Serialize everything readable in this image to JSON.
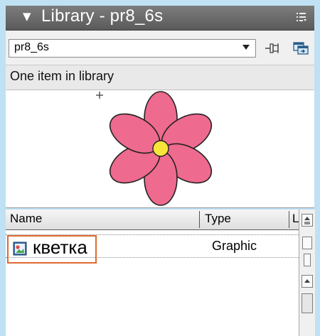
{
  "panel": {
    "title": "Library - pr8_6s",
    "collapse_glyph": "▼",
    "options_icon": "panel-options-icon"
  },
  "toolbar": {
    "selected_library": "pr8_6s",
    "pin_icon": "pin-library-icon",
    "new_window_icon": "new-library-panel-icon"
  },
  "status": {
    "text": "One item in library"
  },
  "preview": {
    "symbol": "flower",
    "petal_color": "#ee6a8e",
    "center_color": "#f7e53a"
  },
  "list": {
    "columns": [
      {
        "label": "Name"
      },
      {
        "label": "Type"
      },
      {
        "label": "Li"
      }
    ],
    "items": [
      {
        "name": "кветка",
        "type": "Graphic",
        "icon": "graphic-symbol-icon"
      }
    ]
  },
  "colors": {
    "background": "#bfe1f3",
    "titlebar": "#6a6a6a",
    "highlight": "#dd6a33"
  }
}
